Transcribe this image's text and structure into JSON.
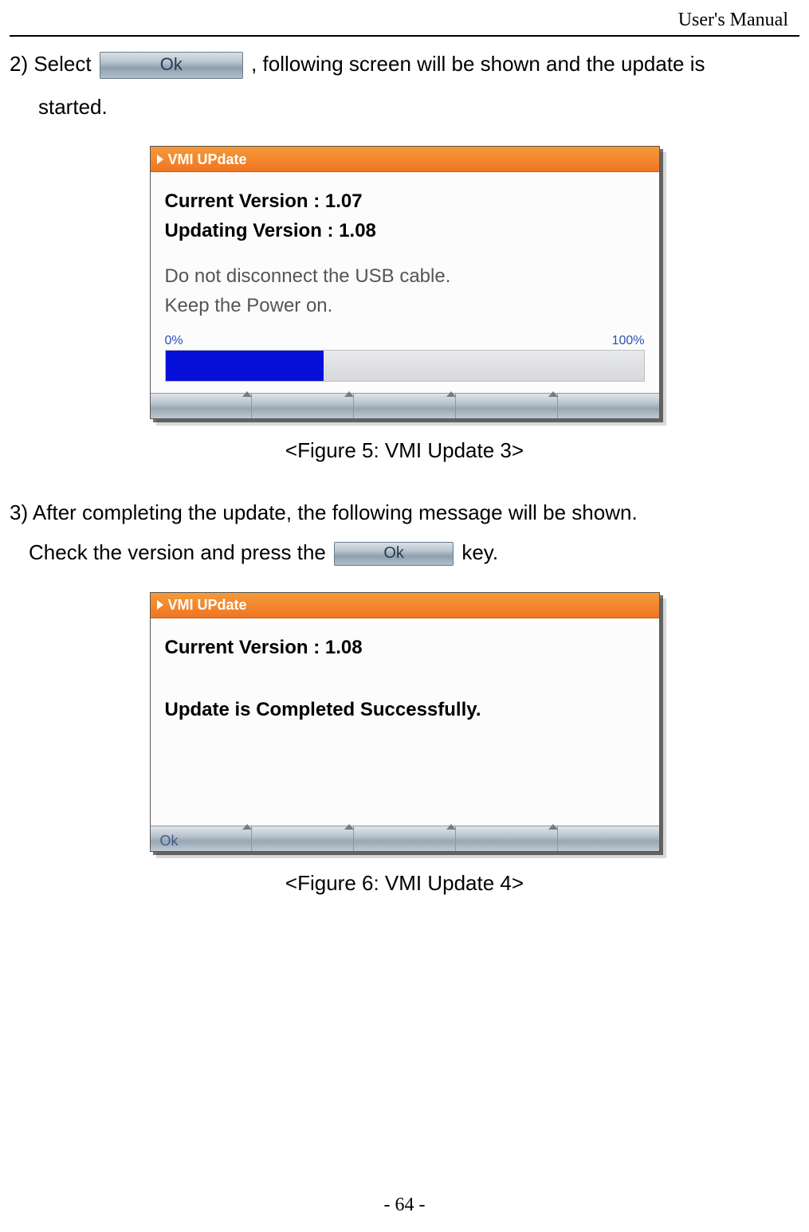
{
  "header": {
    "title": "User's Manual"
  },
  "step2": {
    "prefix": "2) Select ",
    "ok_label": "Ok",
    "suffix": ",  following screen will be shown and the update is",
    "line2": "started."
  },
  "figure5": {
    "titlebar": "VMI UPdate",
    "current_label": "Current Version : 1.07",
    "updating_label": "Updating Version : 1.08",
    "warn1": "Do not disconnect the USB cable.",
    "warn2": "Keep the Power on.",
    "progress_start": "0%",
    "progress_end": "100%",
    "progress_fill_percent": 33,
    "caption": "<Figure 5: VMI Update 3>"
  },
  "step3": {
    "line1": "3) After completing the update, the following message will be shown.",
    "line2_prefix": "Check the version and press the ",
    "ok_label": "Ok",
    "line2_suffix": " key."
  },
  "figure6": {
    "titlebar": "VMI UPdate",
    "current_label": "Current Version : 1.08",
    "result_label": "Update is Completed Successfully.",
    "softkey_ok": "Ok",
    "caption": "<Figure 6: VMI Update 4>"
  },
  "footer": {
    "page": "- 64 -"
  }
}
